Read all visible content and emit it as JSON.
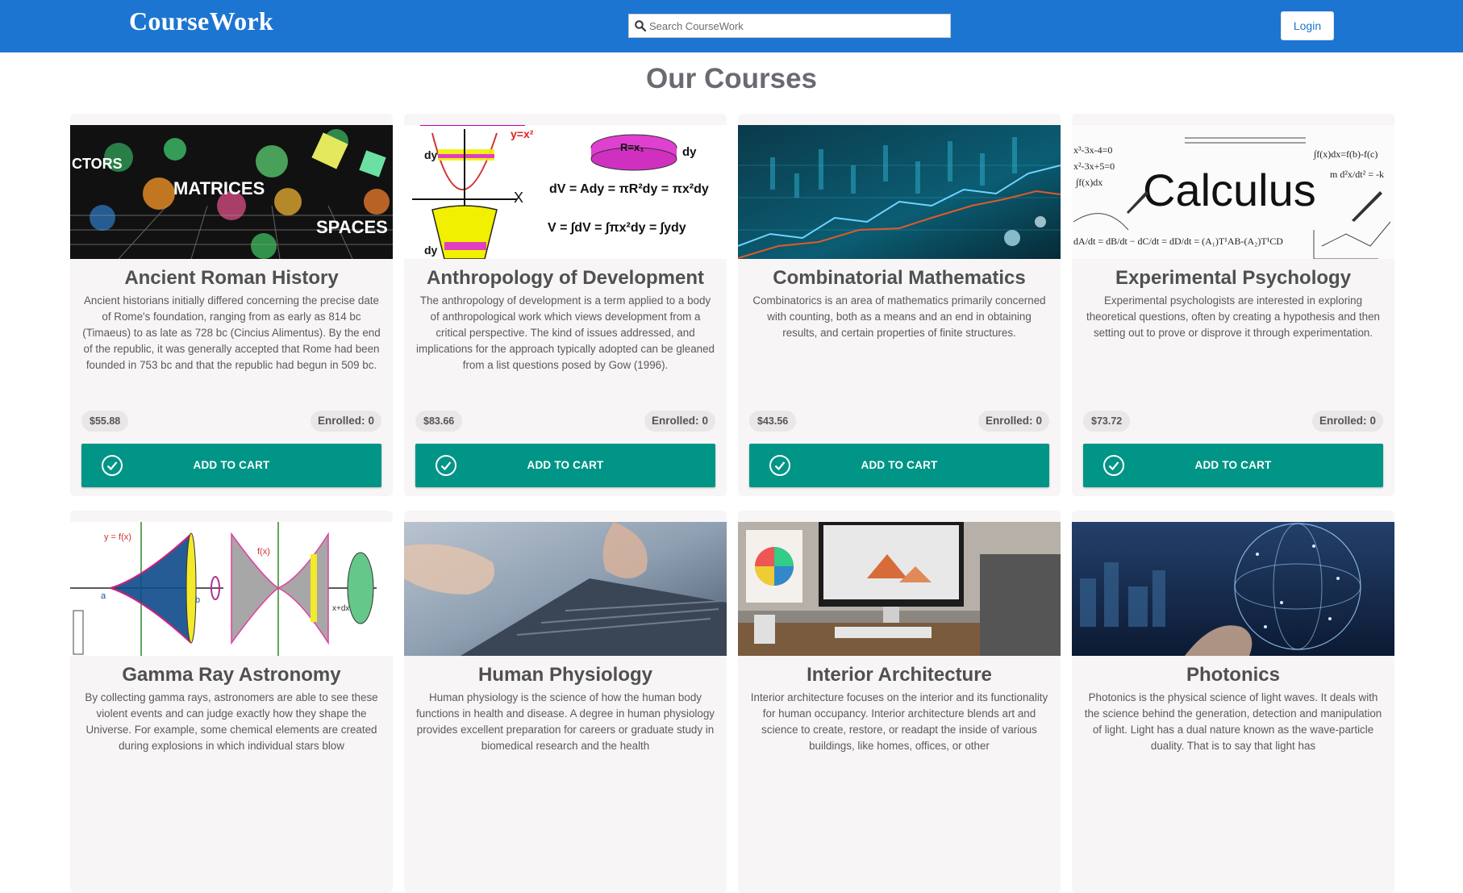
{
  "header": {
    "brand": "CourseWork",
    "search_placeholder": "Search CourseWork",
    "search_value": "",
    "login_label": "Login",
    "bar_color": "#1c75d1"
  },
  "main": {
    "title": "Our Courses",
    "accent_color": "#009587",
    "courses": [
      {
        "title": "Ancient Roman History",
        "image_icon": "matrices-spaces-image",
        "description": "Ancient historians initially differed concerning the precise date of Rome's foundation, ranging from as early as 814 bc (Timaeus) to as late as 728 bc (Cincius Alimentus). By the end of the republic, it was generally accepted that Rome had been founded in 753 bc and that the republic had begun in 509 bc.",
        "price": "$55.88",
        "enrolled_label": "Enrolled:",
        "enrolled_count": "0",
        "cart_label": "ADD TO CART"
      },
      {
        "title": "Anthropology of Development",
        "image_icon": "volume-integral-image",
        "description": "The anthropology of development is a term applied to a body of anthropological work which views development from a critical perspective. The kind of issues addressed, and implications for the approach typically adopted can be gleaned from a list questions posed by Gow (1996).",
        "price": "$83.66",
        "enrolled_label": "Enrolled:",
        "enrolled_count": "0",
        "cart_label": "ADD TO CART"
      },
      {
        "title": "Combinatorial Mathematics",
        "image_icon": "financial-chart-image",
        "description": "Combinatorics is an area of mathematics primarily concerned with counting, both as a means and an end in obtaining results, and certain properties of finite structures.",
        "price": "$43.56",
        "enrolled_label": "Enrolled:",
        "enrolled_count": "0",
        "cart_label": "ADD TO CART"
      },
      {
        "title": "Experimental Psychology",
        "image_icon": "calculus-image",
        "description": "Experimental psychologists are interested in exploring theoretical questions, often by creating a hypothesis and then setting out to prove or disprove it through experimentation.",
        "price": "$73.72",
        "enrolled_label": "Enrolled:",
        "enrolled_count": "0",
        "cart_label": "ADD TO CART"
      },
      {
        "title": "Gamma Ray Astronomy",
        "image_icon": "solid-of-revolution-image",
        "description": "By collecting gamma rays, astronomers are able to see these violent events and can judge exactly how they shape the Universe. For example, some chemical elements are created during explosions in which individual stars blow",
        "price": "",
        "enrolled_label": "",
        "enrolled_count": "",
        "cart_label": ""
      },
      {
        "title": "Human Physiology",
        "image_icon": "laptop-typing-image",
        "description": "Human physiology is the science of how the human body functions in health and disease. A degree in human physiology provides excellent preparation for careers or graduate study in biomedical research and the health",
        "price": "",
        "enrolled_label": "",
        "enrolled_count": "",
        "cart_label": ""
      },
      {
        "title": "Interior Architecture",
        "image_icon": "design-desk-image",
        "description": "Interior architecture focuses on the interior and its functionality for human occupancy. Interior architecture blends art and science to create, restore, or readapt the inside of various buildings, like homes, offices, or other",
        "price": "",
        "enrolled_label": "",
        "enrolled_count": "",
        "cart_label": ""
      },
      {
        "title": "Photonics",
        "image_icon": "digital-globe-image",
        "description": "Photonics is the physical science of light waves. It deals with the science behind the generation, detection and manipulation of light. Light has a dual nature known as the wave-particle duality. That is to say that light has",
        "price": "",
        "enrolled_label": "",
        "enrolled_count": "",
        "cart_label": ""
      }
    ]
  }
}
